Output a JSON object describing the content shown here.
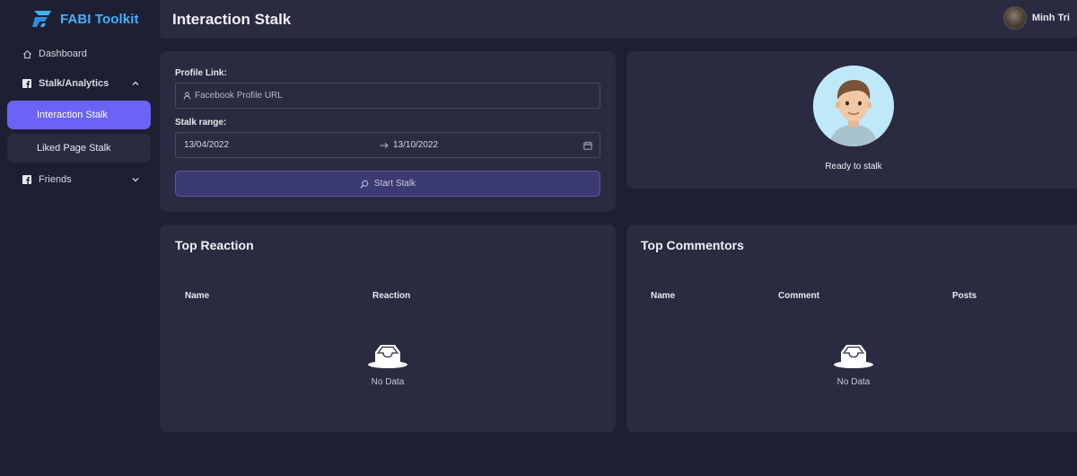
{
  "app": {
    "name": "FABI Toolkit",
    "accent": "#6a63f5",
    "brand_color": "#3fb3ff"
  },
  "sidebar": {
    "items": [
      {
        "label": "Dashboard",
        "icon": "home-icon"
      },
      {
        "label": "Stalk/Analytics",
        "icon": "facebook-icon",
        "expanded": true,
        "children": [
          {
            "label": "Interaction Stalk",
            "active": true
          },
          {
            "label": "Liked Page Stalk",
            "active": false
          }
        ]
      },
      {
        "label": "Friends",
        "icon": "facebook-icon",
        "expanded": false
      }
    ]
  },
  "header": {
    "title": "Interaction Stalk",
    "user_name": "Minh Tri"
  },
  "form": {
    "profile_label": "Profile Link:",
    "profile_placeholder": "Facebook Profile URL",
    "range_label": "Stalk range:",
    "start_date": "13/04/2022",
    "end_date": "13/10/2022",
    "button_label": "Start Stalk"
  },
  "profile": {
    "status": "Ready to stalk"
  },
  "top_reaction": {
    "title": "Top Reaction",
    "columns": [
      "Name",
      "Reaction"
    ],
    "empty_text": "No Data"
  },
  "top_commentors": {
    "title": "Top Commentors",
    "columns": [
      "Name",
      "Comment",
      "Posts"
    ],
    "empty_text": "No Data"
  }
}
